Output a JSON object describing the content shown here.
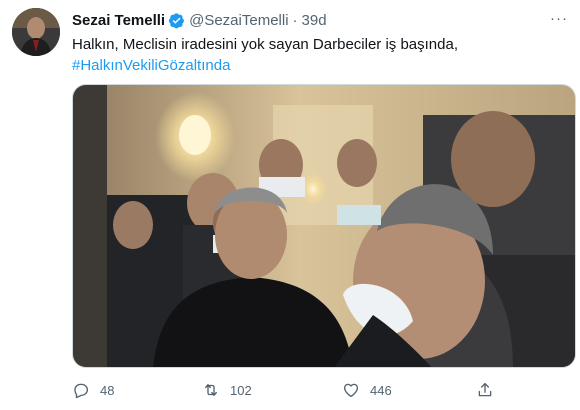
{
  "tweet": {
    "display_name": "Sezai Temelli",
    "handle": "@SezaiTemelli",
    "separator": "·",
    "time": "39d",
    "text_line1": "Halkın, Meclisin iradesini yok sayan Darbeciler iş başında,",
    "hashtag": "#HalkınVekiliGözaltında",
    "more_label": "···",
    "verified_color": "#1d9bf0"
  },
  "actions": {
    "reply_count": "48",
    "retweet_count": "102",
    "like_count": "446"
  },
  "icons": [
    "avatar-image",
    "verified-badge-icon",
    "reply-icon",
    "retweet-icon",
    "like-icon",
    "share-icon"
  ],
  "colors": {
    "text": "#0f1419",
    "secondary": "#536471",
    "link": "#1d9bf0"
  }
}
